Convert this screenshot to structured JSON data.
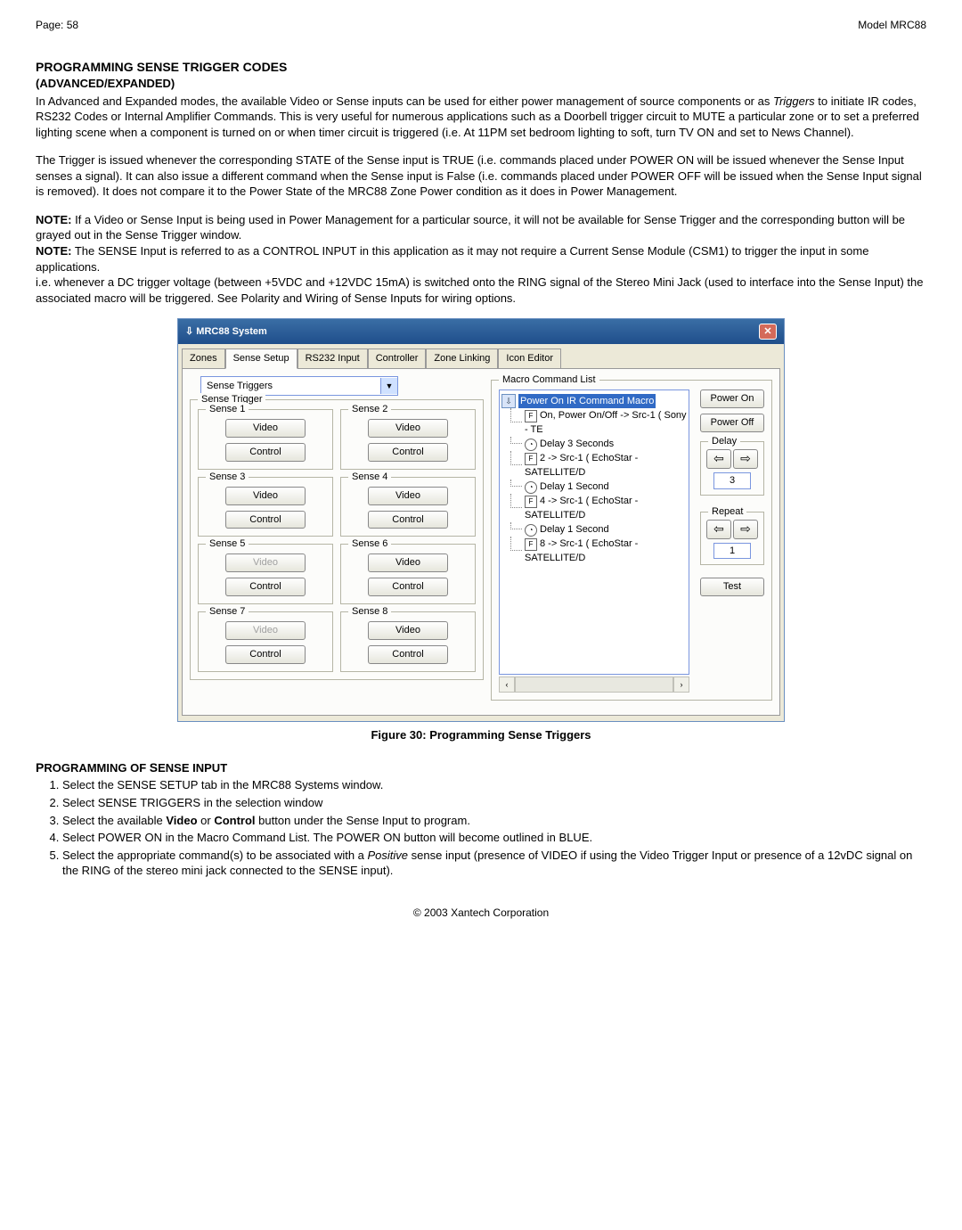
{
  "header": {
    "page_left": "Page: 58",
    "page_right": "Model MRC88"
  },
  "title1": "PROGRAMMING SENSE TRIGGER CODES",
  "title2": "(ADVANCED/EXPANDED)",
  "para1_a": "In Advanced and Expanded modes, the available Video or Sense inputs can be used for either power management of source components or as ",
  "para1_em": "Triggers",
  "para1_b": " to initiate IR codes, RS232 Codes or Internal Amplifier Commands. This is very useful for numerous applications such as a Doorbell trigger circuit to MUTE a particular zone or to set a preferred lighting scene when a component is turned on or when timer circuit is triggered (i.e. At 11PM set bedroom lighting to soft, turn TV ON and set to News Channel).",
  "para2": "The Trigger is issued whenever the corresponding STATE of the Sense input is TRUE (i.e. commands placed under POWER ON will be issued whenever the Sense Input senses a signal). It can also issue a different command when the Sense input is False (i.e. commands placed under POWER OFF will be issued when the Sense Input signal is removed). It does not compare it to the Power State of the MRC88 Zone Power condition as it does in Power Management.",
  "note1_label": "NOTE:",
  "note1": " If a Video or Sense Input is being used in Power Management for a particular source, it will not be available for Sense Trigger and the corresponding button will be grayed out in the Sense Trigger window.",
  "note2_label": "NOTE:",
  "note2": " The SENSE Input is referred to as a CONTROL INPUT in this application as it may not require a Current Sense Module (CSM1) to trigger the input in some applications.",
  "para3": "i.e. whenever a DC trigger voltage (between +5VDC and +12VDC 15mA) is switched onto the RING signal of the Stereo Mini Jack (used to interface into the Sense Input) the associated macro will be triggered. See Polarity and Wiring of Sense Inputs for wiring options.",
  "window": {
    "title": "MRC88 System",
    "tabs": [
      "Zones",
      "Sense Setup",
      "RS232 Input",
      "Controller",
      "Zone Linking",
      "Icon Editor"
    ],
    "active_tab": 1,
    "dropdown_value": "Sense Triggers",
    "outer_group": "Sense Trigger",
    "sense": [
      {
        "legend": "Sense 1",
        "video": "Video",
        "control": "Control",
        "vdis": false,
        "cdis": false
      },
      {
        "legend": "Sense 2",
        "video": "Video",
        "control": "Control",
        "vdis": false,
        "cdis": false
      },
      {
        "legend": "Sense 3",
        "video": "Video",
        "control": "Control",
        "vdis": false,
        "cdis": false
      },
      {
        "legend": "Sense 4",
        "video": "Video",
        "control": "Control",
        "vdis": false,
        "cdis": false
      },
      {
        "legend": "Sense 5",
        "video": "Video",
        "control": "Control",
        "vdis": true,
        "cdis": false
      },
      {
        "legend": "Sense 6",
        "video": "Video",
        "control": "Control",
        "vdis": false,
        "cdis": false
      },
      {
        "legend": "Sense 7",
        "video": "Video",
        "control": "Control",
        "vdis": true,
        "cdis": false
      },
      {
        "legend": "Sense 8",
        "video": "Video",
        "control": "Control",
        "vdis": false,
        "cdis": false
      }
    ],
    "macro": {
      "legend": "Macro Command List",
      "root": "Power On IR Command Macro",
      "nodes": [
        {
          "icon": "F",
          "label": "On, Power On/Off -> Src-1 ( Sony - TE"
        },
        {
          "icon": "clock",
          "label": "Delay 3 Seconds"
        },
        {
          "icon": "F",
          "label": "2 -> Src-1 ( EchoStar - SATELLITE/D"
        },
        {
          "icon": "clock",
          "label": "Delay 1 Second"
        },
        {
          "icon": "F",
          "label": "4 -> Src-1 ( EchoStar - SATELLITE/D"
        },
        {
          "icon": "clock",
          "label": "Delay 1 Second"
        },
        {
          "icon": "F",
          "label": "8 -> Src-1 ( EchoStar - SATELLITE/D"
        }
      ],
      "side": {
        "power_on": "Power On",
        "power_off": "Power Off",
        "delay_label": "Delay",
        "delay_value": "3",
        "repeat_label": "Repeat",
        "repeat_value": "1",
        "test": "Test"
      }
    }
  },
  "figure_caption": "Figure 30: Programming Sense Triggers",
  "steps_heading_a": "P",
  "steps_heading_b": "ROGRAMMING OF ",
  "steps_heading_c": "S",
  "steps_heading_d": "ENSE INPUT",
  "steps": {
    "s1": "Select the SENSE SETUP tab in the MRC88 Systems window.",
    "s2": "Select SENSE TRIGGERS in the selection window",
    "s3_a": "Select the available ",
    "s3_b": "Video",
    "s3_c": " or ",
    "s3_d": "Control",
    "s3_e": " button under the Sense Input to program.",
    "s4": "Select POWER ON in the Macro Command List. The POWER ON button will become outlined in BLUE.",
    "s5_a": "Select the appropriate command(s) to be associated with a ",
    "s5_em": "Positive",
    "s5_b": " sense input (presence of VIDEO if using the Video Trigger Input or presence of a 12vDC signal on the RING of the stereo mini jack connected to the SENSE input)."
  },
  "footer": "© 2003 Xantech Corporation"
}
